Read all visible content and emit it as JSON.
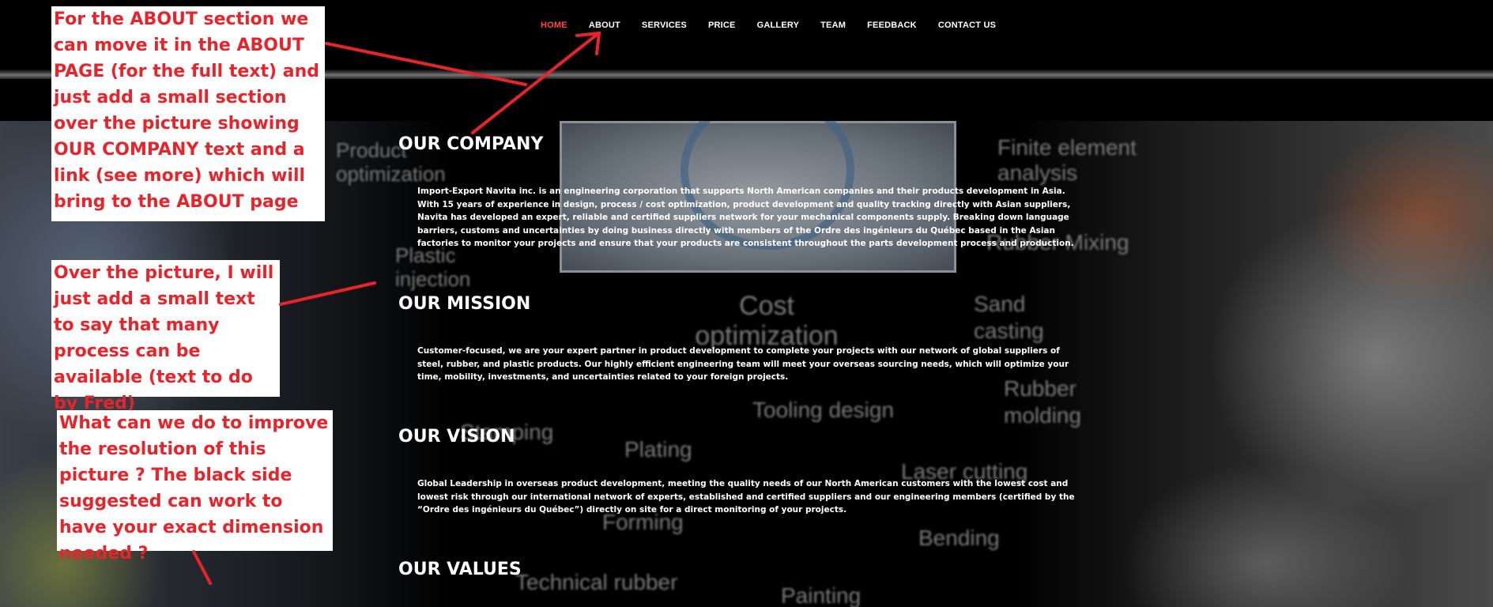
{
  "nav": {
    "items": [
      "HOME",
      "ABOUT",
      "SERVICES",
      "PRICE",
      "GALLERY",
      "TEAM",
      "FEEDBACK",
      "CONTACT US"
    ],
    "active_index": 0
  },
  "background": {
    "words": [
      "Product optimization",
      "Plastic injection",
      "Cost optimization",
      "Finite element analysis",
      "Rubber Mixing",
      "Sand casting",
      "Rubber molding",
      "Tooling design",
      "Stamping",
      "Plating",
      "Laser cutting",
      "Forming",
      "Bending",
      "Technical rubber",
      "Painting"
    ]
  },
  "sections": [
    {
      "title": "OUR COMPANY",
      "body": "Import-Export Navita inc. is an engineering corporation that supports North American companies and their products development in Asia. With 15 years of experience in design, process / cost optimization, product development and quality tracking directly with Asian suppliers, Navita has developed an expert, reliable and certified suppliers network for your mechanical components supply. Breaking down language barriers, customs and uncertainties by doing business directly with members of the Ordre des ingénieurs du Québec based in the Asian factories to monitor your projects and ensure that your products are consistent throughout the parts development process and production."
    },
    {
      "title": "OUR MISSION",
      "body": "Customer-focused, we are your expert partner in product development to complete your projects with our network of global suppliers of steel, rubber, and plastic products. Our highly efficient engineering team will meet your overseas sourcing needs, which will optimize your time, mobility, investments, and uncertainties related to your foreign projects."
    },
    {
      "title": "OUR VISION",
      "body": "Global Leadership in overseas product development, meeting the quality needs of our North American customers with the lowest cost and lowest risk through our international network of experts, established and certified suppliers and our engineering members (certified by the “Ordre des ingénieurs du Québec”) directly on site for a direct monitoring of your projects."
    },
    {
      "title": "OUR VALUES",
      "body": ""
    }
  ],
  "annotations": {
    "note1": "For the ABOUT section we can move it in the ABOUT PAGE (for the full text) and just add a small section over the picture showing OUR COMPANY text and a link (see more) which will bring to the ABOUT page",
    "note2": "Over the picture, I will just add a small text to say that many process can be available (text to do by Fred)",
    "note3": "What can we do to improve the resolution of this picture ? The black side suggested can work to have your exact dimension needed ?",
    "color": "#e8242b"
  },
  "colors": {
    "nav_active": "#ff4747",
    "page_background": "#000000"
  }
}
